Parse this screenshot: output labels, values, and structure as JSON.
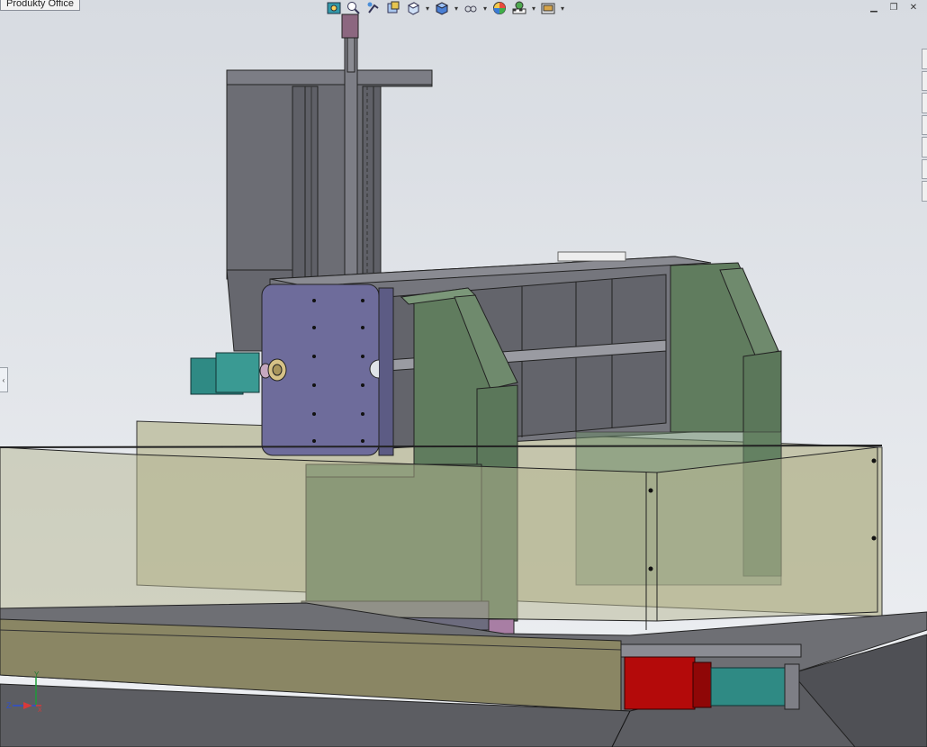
{
  "office_tab": {
    "label": "Produkty Office"
  },
  "hud": {
    "tools": [
      {
        "id": "zoom-to-fit",
        "icon": "zoom-to-fit-icon"
      },
      {
        "id": "zoom-area",
        "icon": "zoom-area-icon"
      },
      {
        "id": "previous-view",
        "icon": "previous-view-icon"
      },
      {
        "id": "section-view",
        "icon": "section-view-icon"
      },
      {
        "id": "view-orientation",
        "icon": "view-orientation-icon"
      },
      {
        "id": "display-style",
        "icon": "display-style-icon"
      },
      {
        "id": "hide-show",
        "icon": "hide-show-icon"
      },
      {
        "id": "edit-appearance",
        "icon": "edit-appearance-icon"
      },
      {
        "id": "apply-scene",
        "icon": "apply-scene-icon"
      },
      {
        "id": "view-settings",
        "icon": "view-settings-icon"
      }
    ]
  },
  "triad": {
    "z_label": "Z",
    "x_label": "X",
    "y_label": "Y"
  },
  "colors": {
    "background": "#dfe3e8",
    "green_parts": "#607c5e",
    "purple_plate": "#6d6b99",
    "gray_frame": "#77787f",
    "motor_teal": "#2f8a84",
    "motor_red": "#b40a0a",
    "glass": "#b8b894"
  }
}
